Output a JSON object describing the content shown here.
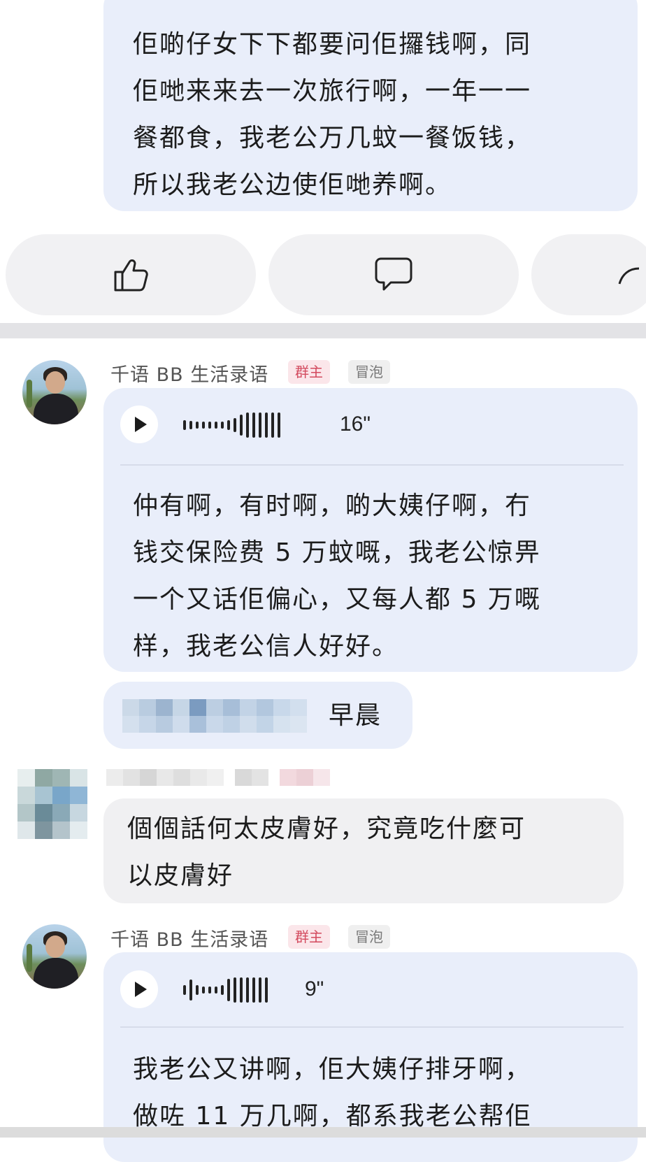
{
  "top_bubble": {
    "text": "佢啲仔女下下都要问佢攞钱啊，同\n佢哋来来去一次旅行啊，一年一一\n餐都食，我老公万几蚊一餐饭钱，\n所以我老公边使佢哋养啊。"
  },
  "actions": {
    "like_icon": "thumbs-up-icon",
    "comment_icon": "comment-icon",
    "share_icon": "share-icon"
  },
  "messages": [
    {
      "username": "千语 BB 生活录语",
      "tag_owner": "群主",
      "tag_bubble": "冒泡",
      "voice_duration": "16\"",
      "text": "仲有啊，有时啊，啲大姨仔啊，冇\n钱交保险费 5 万蚊嘅，我老公惊畀\n一个又话佢偏心，又每人都 5 万嘅\n样，我老公信人好好。"
    },
    {
      "reply_visible_text": "早晨"
    },
    {
      "text": "個個話何太皮膚好，究竟吃什麼可\n以皮膚好"
    },
    {
      "username": "千语 BB 生活录语",
      "tag_owner": "群主",
      "tag_bubble": "冒泡",
      "voice_duration": "9\"",
      "text": "我老公又讲啊，佢大姨仔排牙啊，\n做咗 11 万几啊，都系我老公帮佢"
    }
  ],
  "colors": {
    "bubble_bg": "#e9eefa",
    "owner_tag": "#d34b5f",
    "grey_bubble": "#f0f0f2"
  }
}
